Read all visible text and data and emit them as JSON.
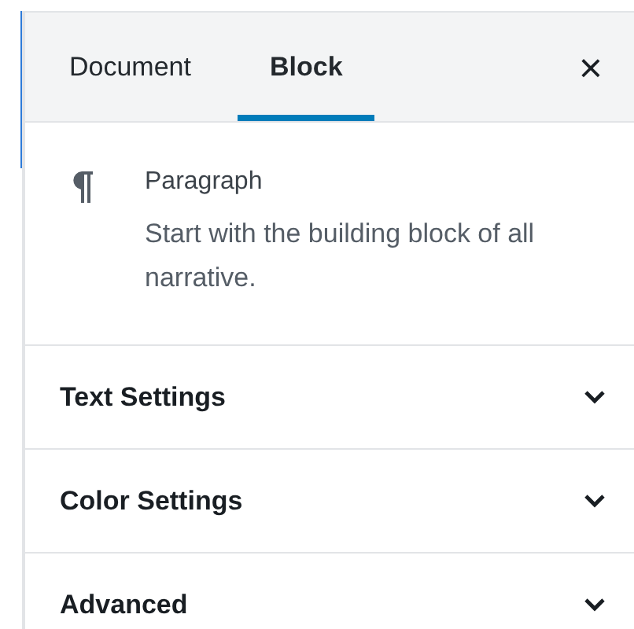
{
  "tabs": [
    {
      "label": "Document",
      "selected": false
    },
    {
      "label": "Block",
      "selected": true
    }
  ],
  "close": {
    "label": "×"
  },
  "block_card": {
    "title": "Paragraph",
    "description": "Start with the building block of all narrative."
  },
  "panels": [
    {
      "title": "Text Settings",
      "expanded": false
    },
    {
      "title": "Color Settings",
      "expanded": false
    },
    {
      "title": "Advanced",
      "expanded": false
    }
  ]
}
